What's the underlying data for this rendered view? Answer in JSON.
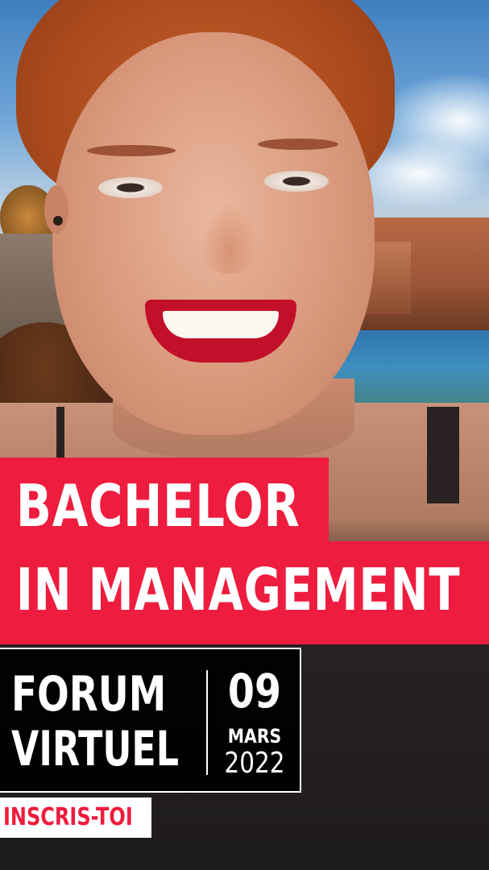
{
  "headline": {
    "line1": "BACHELOR",
    "line2": "IN MANAGEMENT"
  },
  "event": {
    "title_line1": "FORUM",
    "title_line2": "VIRTUEL",
    "day": "09",
    "month": "MARS",
    "year": "2022"
  },
  "cta": {
    "label": "INSCRIS-TOI"
  },
  "colors": {
    "accent_red": "#ee1c3e",
    "box_black": "#000000",
    "text_white": "#ffffff"
  }
}
